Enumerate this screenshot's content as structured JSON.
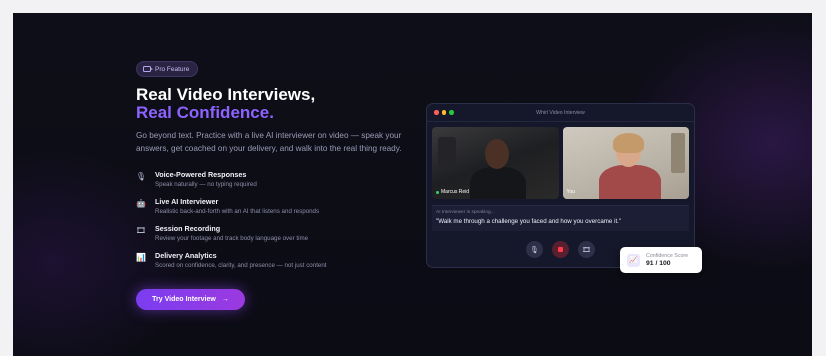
{
  "badge": {
    "icon": "video-camera-icon",
    "label": "Pro Feature"
  },
  "hero": {
    "title_line1": "Real Video Interviews,",
    "title_line2": "Real Confidence.",
    "description": "Go beyond text. Practice with a live AI interviewer on video — speak your answers, get coached on your delivery, and walk into the real thing ready."
  },
  "features": [
    {
      "icon": "microphone-icon",
      "title": "Voice-Powered Responses",
      "subtitle": "Speak naturally — no typing required"
    },
    {
      "icon": "robot-icon",
      "title": "Live AI Interviewer",
      "subtitle": "Realistic back-and-forth with an AI that listens and responds"
    },
    {
      "icon": "film-icon",
      "title": "Session Recording",
      "subtitle": "Review your footage and track body language over time"
    },
    {
      "icon": "bar-chart-icon",
      "title": "Delivery Analytics",
      "subtitle": "Scored on confidence, clarity, and presence — not just content"
    }
  ],
  "cta": {
    "label": "Try Video Interview",
    "arrow": "→"
  },
  "video_window": {
    "title": "Whirl Video Interview",
    "participants": [
      {
        "name": "Marcus Reid"
      },
      {
        "name": "You"
      }
    ],
    "speaking_status": "AI Interviewer is speaking...",
    "question": "\"Walk me through a challenge you faced and how you overcame it.\"",
    "controls": [
      "microphone-icon",
      "stop-record-icon",
      "film-icon"
    ]
  },
  "score_card": {
    "label": "Confidence Score",
    "value": "91 / 100"
  },
  "colors": {
    "accent": "#8d63ff",
    "cta_start": "#7b3df0",
    "cta_end": "#9b3ae0",
    "dot_red": "#ff5f57",
    "dot_yellow": "#febc2e",
    "dot_green": "#28c840"
  }
}
